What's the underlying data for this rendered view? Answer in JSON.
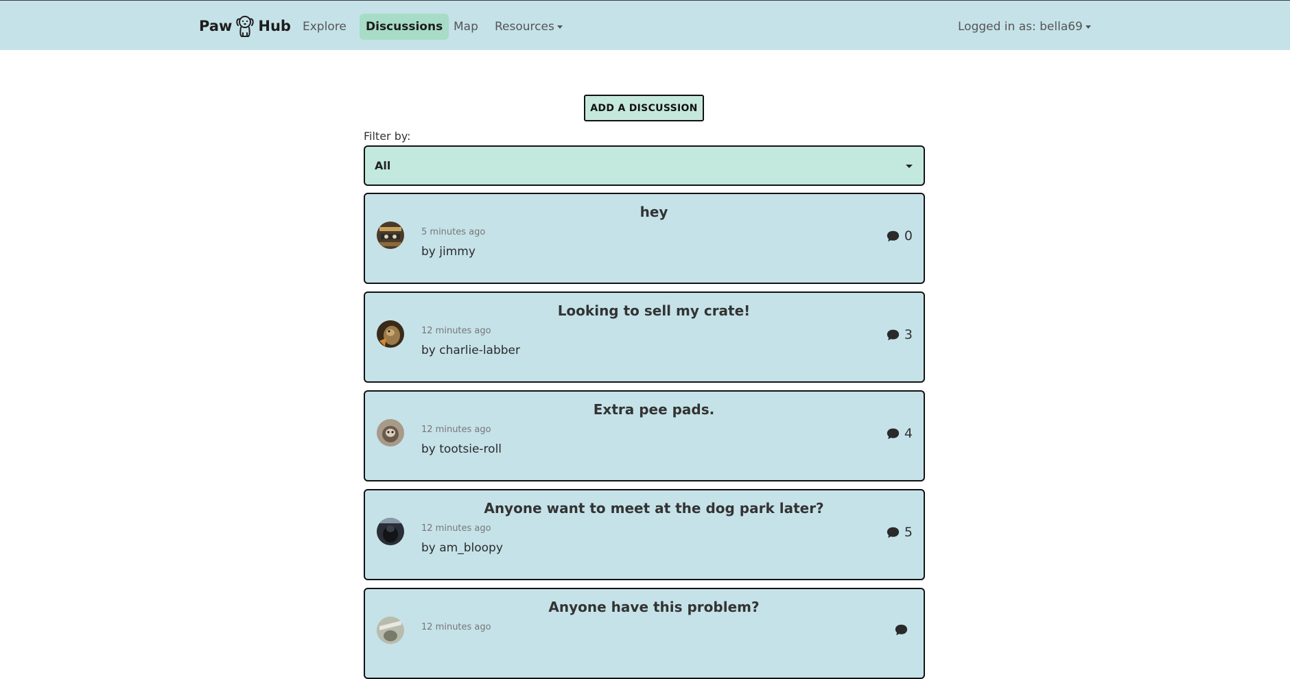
{
  "nav": {
    "brand_left": "Paw",
    "brand_right": "Hub",
    "links": [
      {
        "label": "Explore"
      },
      {
        "label": "Discussions",
        "active": true
      },
      {
        "label": "Map"
      },
      {
        "label": "Resources"
      }
    ],
    "user_label": "Logged in as: bella69"
  },
  "add_button_label": "ADD A DISCUSSION",
  "filter": {
    "label": "Filter by:",
    "selected": "All"
  },
  "discussions": [
    {
      "title": "hey",
      "time": "5 minutes ago",
      "author": "by jimmy",
      "comments": "0"
    },
    {
      "title": "Looking to sell my crate!",
      "time": "12 minutes ago",
      "author": "by charlie-labber",
      "comments": "3"
    },
    {
      "title": "Extra pee pads.",
      "time": "12 minutes ago",
      "author": "by tootsie-roll",
      "comments": "4"
    },
    {
      "title": "Anyone want to meet at the dog park later?",
      "time": "12 minutes ago",
      "author": "by am_bloopy",
      "comments": "5"
    },
    {
      "title": "Anyone have this problem?",
      "time": "12 minutes ago",
      "author": "",
      "comments": ""
    }
  ],
  "colors": {
    "nav_bg": "#c5e2e8",
    "active_tab": "#a7dcc6",
    "card_bg": "#c5e2e8",
    "select_bg": "#c3e8dd"
  }
}
